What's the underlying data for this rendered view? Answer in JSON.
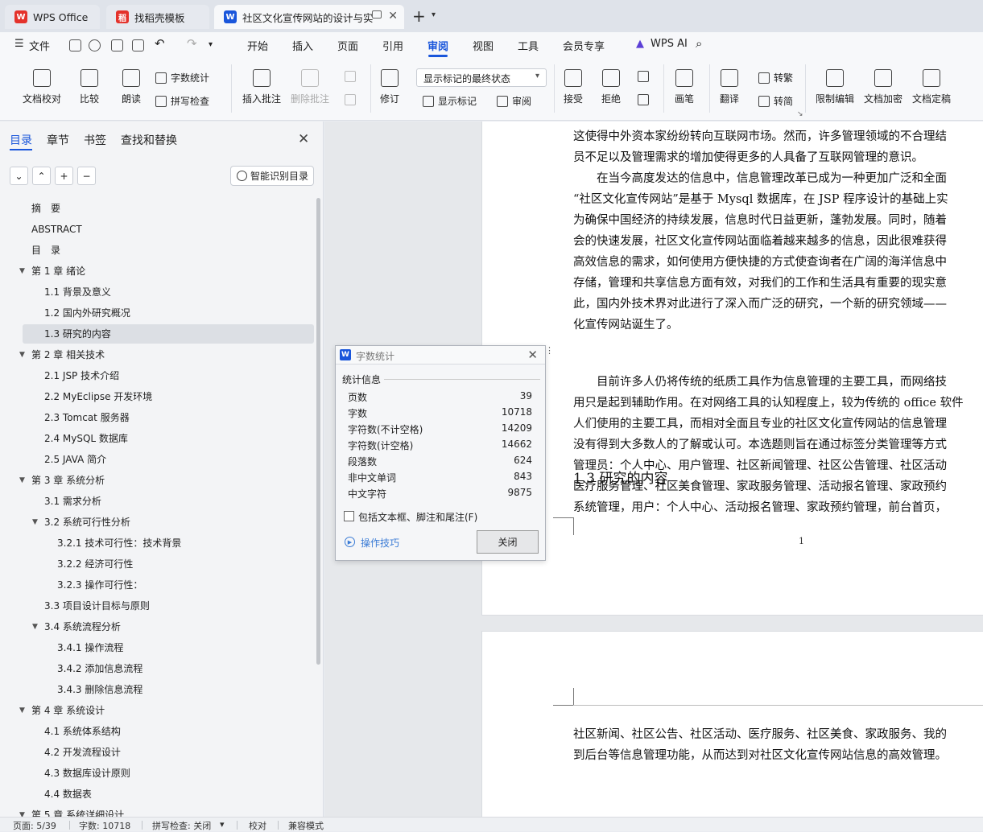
{
  "tabs": [
    {
      "label": "WPS Office",
      "icon": "wps-logo-icon",
      "color": "#e4322b"
    },
    {
      "label": "找稻壳模板",
      "icon": "docer-icon",
      "color": "#e4322b"
    },
    {
      "label": "社区文化宣传网站的设计与实",
      "icon": "word-doc-icon",
      "color": "#1a56db",
      "active": true
    }
  ],
  "menu": {
    "file": "文件",
    "items": [
      "开始",
      "插入",
      "页面",
      "引用",
      "审阅",
      "视图",
      "工具",
      "会员专享"
    ],
    "active": "审阅",
    "ai": "WPS AI"
  },
  "ribbon": {
    "doc_check": "文档校对",
    "compare": "比较",
    "read": "朗读",
    "word_count": "字数统计",
    "spell_check": "拼写检查",
    "insert_comment": "插入批注",
    "delete_comment": "删除批注",
    "revise": "修订",
    "markup_state": "显示标记的最终状态",
    "show_markup": "显示标记",
    "review": "审阅",
    "accept": "接受",
    "reject": "拒绝",
    "pen": "画笔",
    "translate": "翻译",
    "to_traditional": "转繁",
    "to_simplified": "转简",
    "restrict_edit": "限制编辑",
    "encrypt": "文档加密",
    "finalize": "文档定稿"
  },
  "sidebar": {
    "tabs": [
      "目录",
      "章节",
      "书签",
      "查找和替换"
    ],
    "smart_toc": "智能识别目录",
    "toc": [
      {
        "label": "摘　要",
        "level": 0
      },
      {
        "label": "ABSTRACT",
        "level": 0
      },
      {
        "label": "目　录",
        "level": 0
      },
      {
        "label": "第 1 章  绪论",
        "level": 0,
        "expanded": true
      },
      {
        "label": "1.1  背景及意义",
        "level": 1
      },
      {
        "label": "1.2  国内外研究概况",
        "level": 1
      },
      {
        "label": "1.3  研究的内容",
        "level": 1,
        "selected": true
      },
      {
        "label": "第 2 章  相关技术",
        "level": 0,
        "expanded": true
      },
      {
        "label": "2.1 JSP 技术介绍",
        "level": 1
      },
      {
        "label": "2.2 MyEclipse 开发环境",
        "level": 1
      },
      {
        "label": "2.3 Tomcat 服务器",
        "level": 1
      },
      {
        "label": "2.4 MySQL 数据库",
        "level": 1
      },
      {
        "label": "2.5 JAVA 简介",
        "level": 1
      },
      {
        "label": "第 3 章  系统分析",
        "level": 0,
        "expanded": true
      },
      {
        "label": "3.1  需求分析",
        "level": 1
      },
      {
        "label": "3.2  系统可行性分析",
        "level": 1,
        "expanded": true
      },
      {
        "label": "3.2.1 技术可行性：技术背景",
        "level": 2
      },
      {
        "label": "3.2.2 经济可行性",
        "level": 2
      },
      {
        "label": "3.2.3 操作可行性：",
        "level": 2
      },
      {
        "label": "3.3  项目设计目标与原则",
        "level": 1
      },
      {
        "label": "3.4 系统流程分析",
        "level": 1,
        "expanded": true
      },
      {
        "label": "3.4.1 操作流程",
        "level": 2
      },
      {
        "label": "3.4.2 添加信息流程",
        "level": 2
      },
      {
        "label": "3.4.3 删除信息流程",
        "level": 2
      },
      {
        "label": "第 4 章  系统设计",
        "level": 0,
        "expanded": true
      },
      {
        "label": "4.1  系统体系结构",
        "level": 1
      },
      {
        "label": "4.2 开发流程设计",
        "level": 1
      },
      {
        "label": "4.3  数据库设计原则",
        "level": 1
      },
      {
        "label": "4.4  数据表",
        "level": 1
      },
      {
        "label": "第 5 章  系统详细设计",
        "level": 0,
        "expanded": true
      }
    ]
  },
  "document": {
    "page1_lines": [
      "这使得中外资本家纷纷转向互联网市场。然而，许多管理领域的不合理结",
      "员不足以及管理需求的增加使得更多的人具备了互联网管理的意识。",
      "　　在当今高度发达的信息中，信息管理改革已成为一种更加广泛和全面",
      "“社区文化宣传网站”是基于 Mysql 数据库，在 JSP 程序设计的基础上实",
      "为确保中国经济的持续发展，信息时代日益更新，蓬勃发展。同时，随着",
      "会的快速发展，社区文化宣传网站面临着越来越多的信息，因此很难获得",
      "高效信息的需求，如何使用方便快捷的方式使查询者在广阔的海洋信息中",
      "存储，管理和共享信息方面有效，对我们的工作和生活具有重要的现实意",
      "此，国内外技术界对此进行了深入而广泛的研究，一个新的研究领域——",
      "化宣传网站诞生了。"
    ],
    "heading": "1.3  研究的内容",
    "page1_lines2": [
      "　　目前许多人仍将传统的纸质工具作为信息管理的主要工具，而网络技",
      "用只是起到辅助作用。在对网络工具的认知程度上，较为传统的 office 软件",
      "人们使用的主要工具，而相对全面且专业的社区文化宣传网站的信息管理",
      "没有得到大多数人的了解或认可。本选题则旨在通过标签分类管理等方式",
      "管理员：个人中心、用户管理、社区新闻管理、社区公告管理、社区活动",
      "医疗服务管理、社区美食管理、家政服务管理、活动报名管理、家政预约",
      "系统管理，用户：个人中心、活动报名管理、家政预约管理，前台首页，"
    ],
    "page_number": "1",
    "page2_lines": [
      "社区新闻、社区公告、社区活动、医疗服务、社区美食、家政服务、我的",
      "到后台等信息管理功能，从而达到对社区文化宣传网站信息的高效管理。"
    ]
  },
  "dialog": {
    "title": "字数统计",
    "section": "统计信息",
    "stats": [
      {
        "label": "页数",
        "value": "39"
      },
      {
        "label": "字数",
        "value": "10718"
      },
      {
        "label": "字符数(不计空格)",
        "value": "14209"
      },
      {
        "label": "字符数(计空格)",
        "value": "14662"
      },
      {
        "label": "段落数",
        "value": "624"
      },
      {
        "label": "非中文单词",
        "value": "843"
      },
      {
        "label": "中文字符",
        "value": "9875"
      }
    ],
    "include_label": "包括文本框、脚注和尾注(F)",
    "tips": "操作技巧",
    "close": "关闭"
  },
  "status": {
    "page": "页面: 5/39",
    "words": "字数: 10718",
    "spell": "拼写检查: 关闭",
    "proof": "校对",
    "compat": "兼容模式"
  }
}
